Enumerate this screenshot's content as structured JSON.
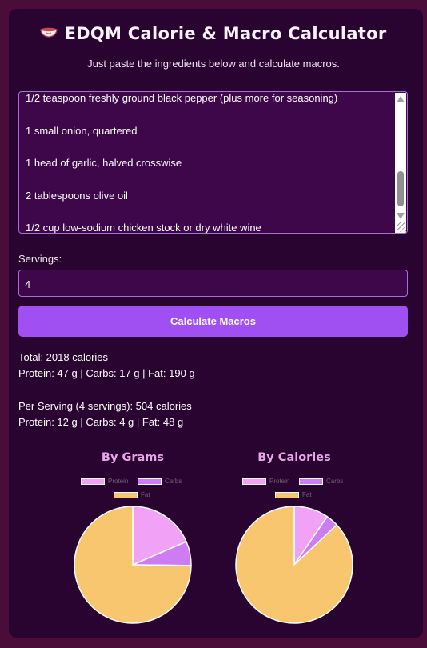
{
  "app": {
    "title": "EDQM Calorie & Macro Calculator",
    "title_icon": "bowl-icon",
    "subtitle": "Just paste the ingredients below and calculate macros."
  },
  "ingredients": {
    "lines": [
      "1/2 teaspoon freshly ground black pepper (plus more for seasoning)",
      "1 small onion, quartered",
      "1 head of garlic, halved crosswise",
      "2 tablespoons olive oil",
      "1/2 cup low-sodium chicken stock or dry white wine"
    ]
  },
  "servings": {
    "label": "Servings:",
    "value": "4"
  },
  "calculate_button": {
    "label": "Calculate Macros"
  },
  "results": {
    "total_line": "Total: 2018 calories",
    "total_macros": "Protein: 47 g | Carbs: 17 g | Fat: 190 g",
    "per_serving_line": "Per Serving (4 servings): 504 calories",
    "per_serving_macros": "Protein: 12 g | Carbs: 4 g | Fat: 48 g"
  },
  "colors": {
    "protein": "#f2a2f6",
    "carbs": "#cd7cf4",
    "fat": "#f8c66e",
    "accent": "#a050f2"
  },
  "chart_data": [
    {
      "type": "pie",
      "title": "By Grams",
      "legend": [
        "Protein",
        "Carbs",
        "Fat"
      ],
      "legend_placement": "top",
      "values": [
        47,
        17,
        190
      ]
    },
    {
      "type": "pie",
      "title": "By Calories",
      "legend": [
        "Protein",
        "Carbs",
        "Fat"
      ],
      "legend_placement": "top",
      "values": [
        188,
        68,
        1710
      ]
    }
  ]
}
